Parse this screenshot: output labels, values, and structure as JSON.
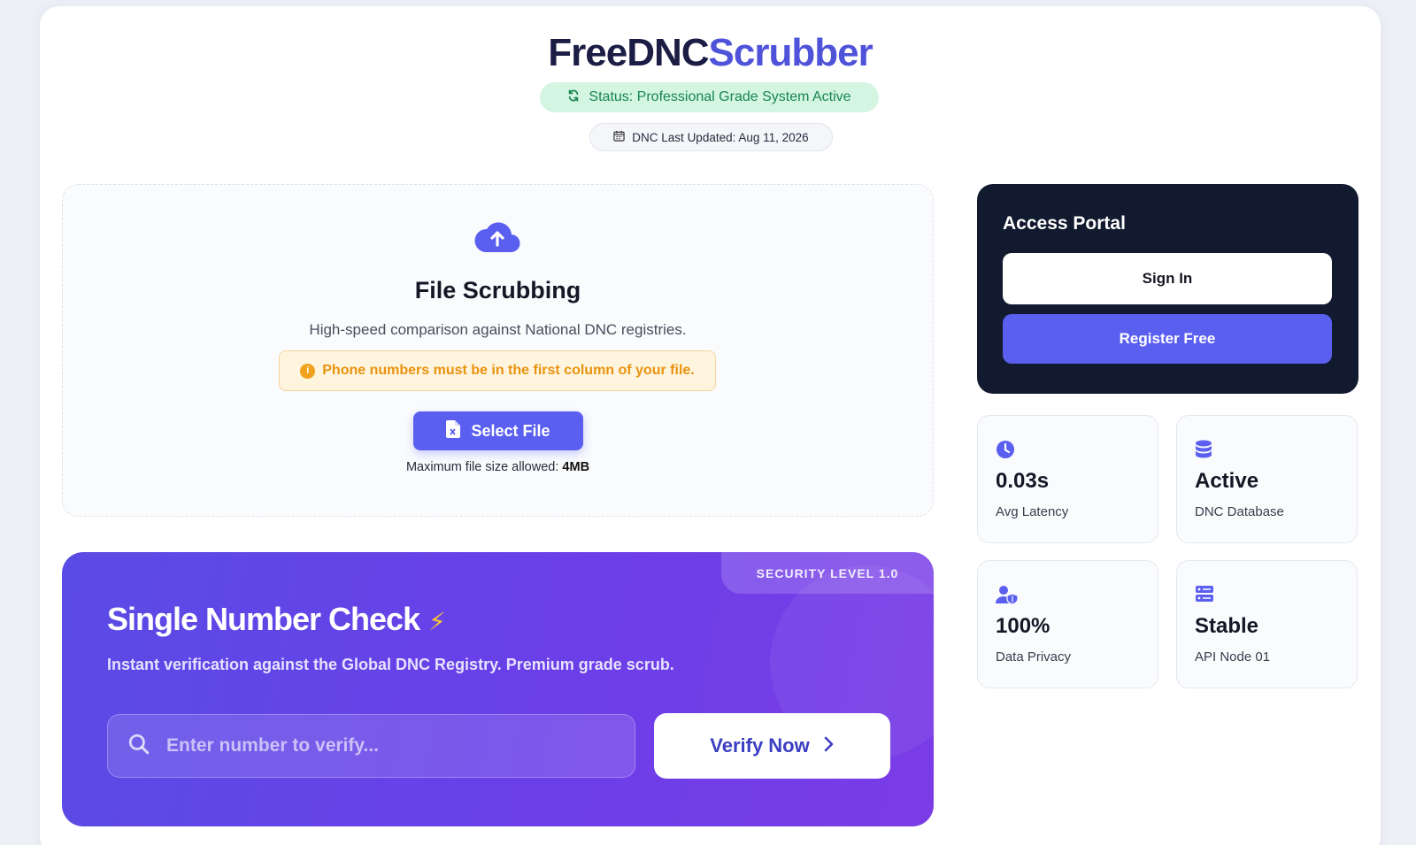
{
  "header": {
    "brand_part1": "FreeDNC",
    "brand_part2": "Scrubber",
    "status": "Status: Professional Grade System Active",
    "updated": "DNC Last Updated: Aug 11, 2026"
  },
  "file_scrubbing": {
    "icon": "cloud-upload-icon",
    "title": "File Scrubbing",
    "subtitle": "High-speed comparison against National DNC registries.",
    "warning": "Phone numbers must be in the first column of your file.",
    "select_label": "Select File",
    "max_size_label": "Maximum file size allowed:",
    "max_size_value": "4MB"
  },
  "single_check": {
    "security_tag": "SECURITY LEVEL 1.0",
    "title": "Single Number Check",
    "bolt": "⚡",
    "subtitle": "Instant verification against the Global DNC Registry. Premium grade scrub.",
    "input_placeholder": "Enter number to verify...",
    "input_value": "",
    "verify_label": "Verify Now"
  },
  "portal": {
    "title": "Access Portal",
    "sign_in": "Sign In",
    "register": "Register Free"
  },
  "stats": [
    {
      "icon": "clock-icon",
      "value": "0.03s",
      "label": "Avg Latency"
    },
    {
      "icon": "database-icon",
      "value": "Active",
      "label": "DNC Database"
    },
    {
      "icon": "user-shield-icon",
      "value": "100%",
      "label": "Data Privacy"
    },
    {
      "icon": "server-icon",
      "value": "Stable",
      "label": "API Node 01"
    }
  ],
  "colors": {
    "accent": "#5b5ff0",
    "brand_dark": "#1b1d45",
    "status_bg": "#d3f5e2",
    "status_text": "#17864f",
    "warning": "#e8930f",
    "portal_bg": "#111a2e"
  }
}
